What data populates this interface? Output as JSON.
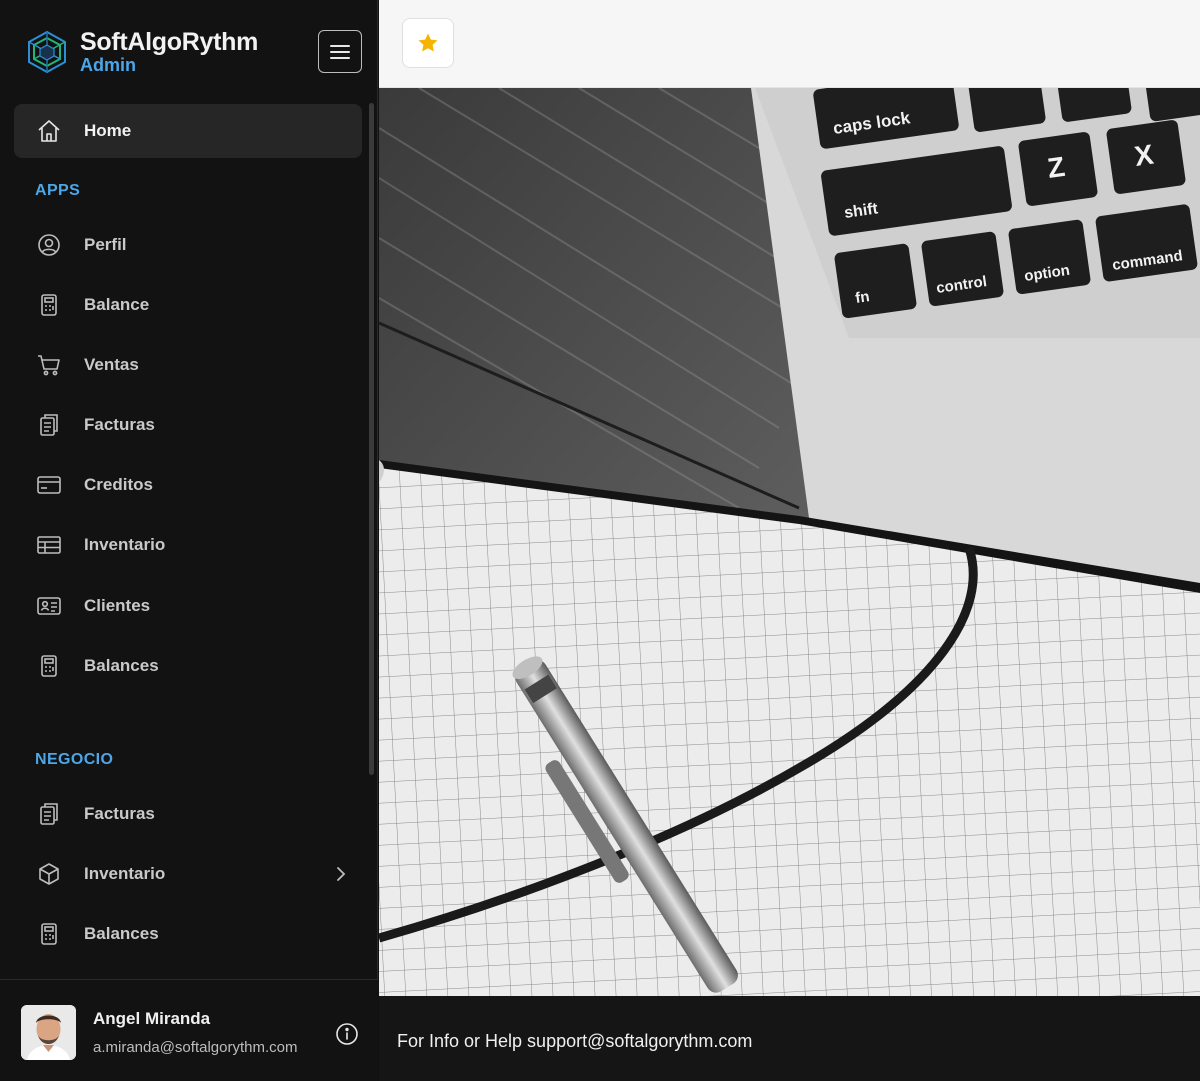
{
  "brand": {
    "name": "SoftAlgoRythm",
    "subtitle": "Admin"
  },
  "header": {
    "favorite_icon": "star-icon",
    "menu_icon": "hamburger-icon"
  },
  "nav": {
    "home": {
      "label": "Home",
      "icon": "home-icon"
    },
    "sections": [
      {
        "label": "APPS",
        "items": [
          {
            "label": "Perfil",
            "icon": "user-circle-icon"
          },
          {
            "label": "Balance",
            "icon": "calculator-icon"
          },
          {
            "label": "Ventas",
            "icon": "cart-icon"
          },
          {
            "label": "Facturas",
            "icon": "invoice-icon"
          },
          {
            "label": "Creditos",
            "icon": "credit-card-icon"
          },
          {
            "label": "Inventario",
            "icon": "table-icon"
          },
          {
            "label": "Clientes",
            "icon": "id-card-icon"
          },
          {
            "label": "Balances",
            "icon": "calculator-icon"
          }
        ]
      },
      {
        "label": "NEGOCIO",
        "items": [
          {
            "label": "Facturas",
            "icon": "invoice-icon"
          },
          {
            "label": "Inventario",
            "icon": "box-icon",
            "expandable": true
          },
          {
            "label": "Balances",
            "icon": "calculator-icon"
          }
        ]
      }
    ]
  },
  "user": {
    "name": "Angel Miranda",
    "email": "a.miranda@softalgorythm.com"
  },
  "footer": {
    "text": "For Info or Help support@softalgorythm.com"
  },
  "colors": {
    "accent": "#4da6e8",
    "sidebar_bg": "#121212",
    "star": "#f5b400"
  }
}
